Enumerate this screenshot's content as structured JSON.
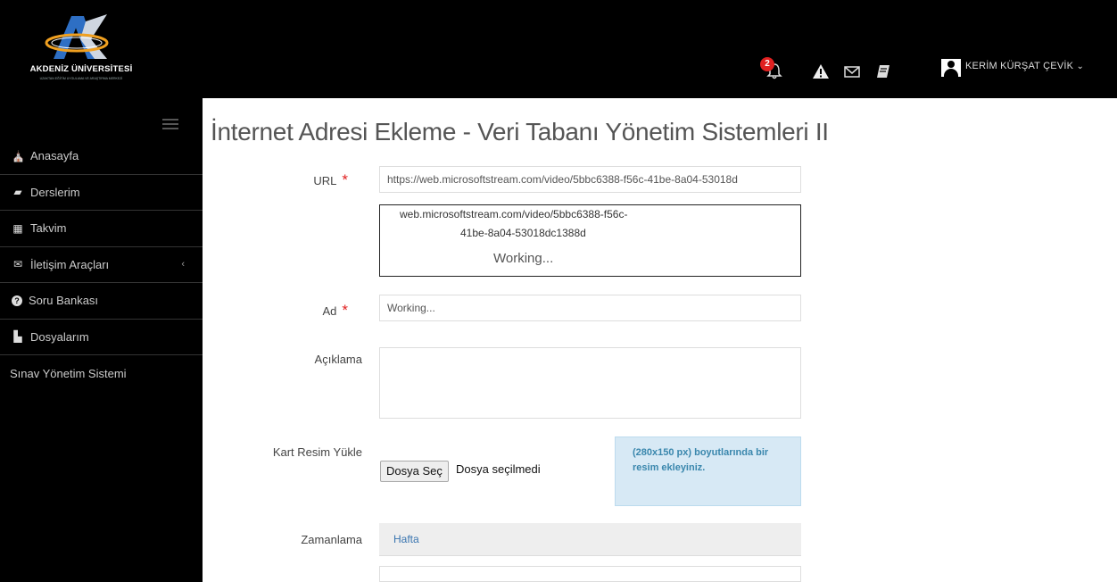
{
  "header": {
    "university_name": "AKDENİZ ÜNİVERSİTESİ",
    "university_subtitle": "UZAKTAN EĞİTİM UYGULAMA VE ARAŞTIRMA MERKEZİ",
    "notification_count": "2",
    "user_name": "KERİM KÜRŞAT ÇEVİK",
    "icons": [
      "bell-icon",
      "warning-icon",
      "envelope-icon",
      "book-icon",
      "user-icon",
      "chevron-down-icon"
    ]
  },
  "sidebar": {
    "items": [
      {
        "label": "Anasayfa",
        "icon": "home-icon",
        "glyph": "⌂"
      },
      {
        "label": "Derslerim",
        "icon": "book-icon",
        "glyph": "▰"
      },
      {
        "label": "Takvim",
        "icon": "calendar-icon",
        "glyph": "▦"
      },
      {
        "label": "İletişim Araçları",
        "icon": "envelope-icon",
        "glyph": "✉",
        "arrow": "‹"
      },
      {
        "label": "Soru Bankası",
        "icon": "question-icon",
        "glyph": "?"
      },
      {
        "label": "Dosyalarım",
        "icon": "file-icon",
        "glyph": "▙"
      },
      {
        "label": "Sınav Yönetim Sistemi"
      }
    ]
  },
  "main": {
    "title": "İnternet Adresi Ekleme - Veri Tabanı Yönetim Sistemleri II",
    "url_label": "URL",
    "url_value": "https://web.microsoftstream.com/video/5bbc6388-f56c-41be-8a04-53018d",
    "preview_line1": "web.microsoftstream.com/video/5bbc6388-f56c-",
    "preview_line2": "41be-8a04-53018dc1388d",
    "preview_status": "Working...",
    "name_label": "Ad",
    "name_value": "Working...",
    "description_label": "Açıklama",
    "card_label": "Kart Resim Yükle",
    "file_button": "Dosya Seç",
    "file_status": "Dosya seçilmedi",
    "info_text": "(280x150 px) boyutlarında bir resim ekleyiniz.",
    "schedule_label": "Zamanlama",
    "schedule_tab": "Hafta",
    "required_mark": "*"
  },
  "colors": {
    "topbar": "#000000",
    "sidebar": "#000000",
    "required": "#e02020",
    "info_bg": "#d7e9f5",
    "info_text": "#3a87ad",
    "link": "#3a75b0"
  }
}
